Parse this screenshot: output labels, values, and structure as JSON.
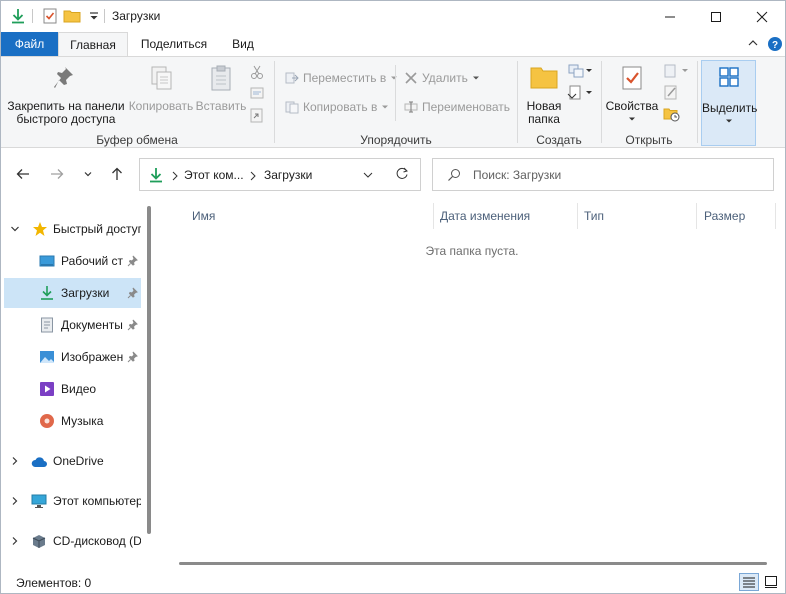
{
  "window": {
    "title": "Загрузки"
  },
  "tabs": {
    "file": "Файл",
    "home": "Главная",
    "share": "Поделиться",
    "view": "Вид"
  },
  "ribbon": {
    "pin_label_line1": "Закрепить на панели",
    "pin_label_line2": "быстрого доступа",
    "copy_label": "Копировать",
    "paste_label": "Вставить",
    "clipboard_group": "Буфер обмена",
    "move_to_label": "Переместить в",
    "copy_to_label": "Копировать в",
    "delete_label": "Удалить",
    "rename_label": "Переименовать",
    "organize_group": "Упорядочить",
    "new_folder_line1": "Новая",
    "new_folder_line2": "папка",
    "create_group": "Создать",
    "properties_label": "Свойства",
    "open_group": "Открыть",
    "select_label": "Выделить"
  },
  "address": {
    "crumb1": "Этот ком...",
    "crumb2": "Загрузки"
  },
  "search": {
    "placeholder": "Поиск: Загрузки"
  },
  "nav": {
    "quick_access": "Быстрый доступ",
    "desktop": "Рабочий стол",
    "downloads": "Загрузки",
    "documents": "Документы",
    "pictures": "Изображения",
    "videos": "Видео",
    "music": "Музыка",
    "onedrive": "OneDrive",
    "this_pc": "Этот компьютер",
    "cd_drive": "CD-дисковод (D:)"
  },
  "columns": {
    "name": "Имя",
    "date": "Дата изменения",
    "type": "Тип",
    "size": "Размер"
  },
  "content": {
    "empty_message": "Эта папка пуста."
  },
  "status": {
    "items": "Элементов: 0"
  },
  "colors": {
    "accent": "#1a6fc4",
    "selection": "#cce4f7",
    "download_green": "#1f9e5a",
    "folder_yellow": "#f5c342"
  }
}
